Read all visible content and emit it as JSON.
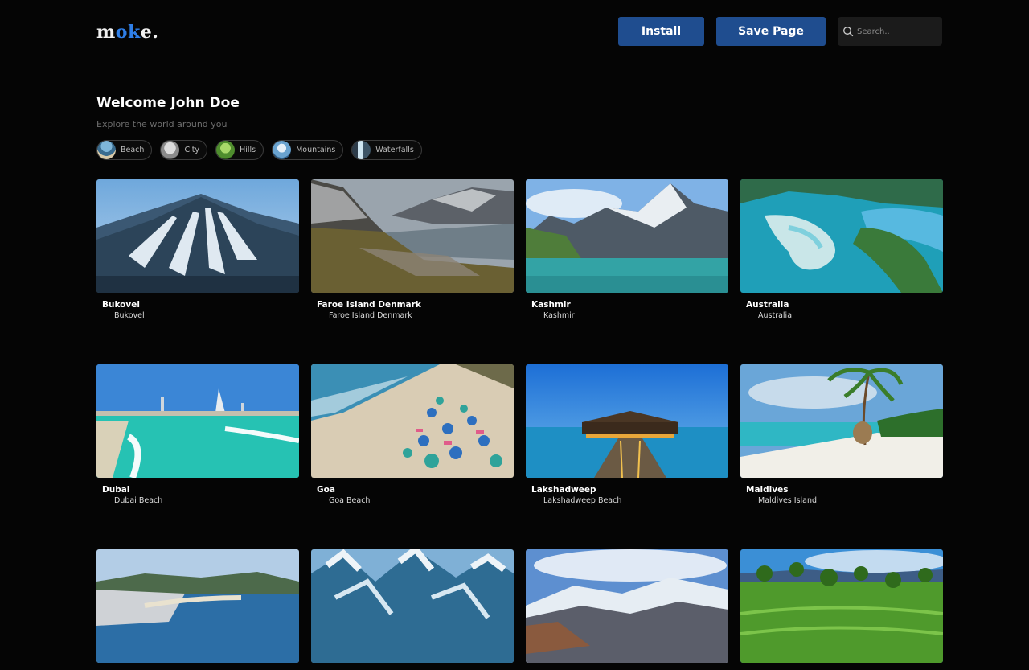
{
  "header": {
    "logo": {
      "part1": "m",
      "part2": "ok",
      "part3": "e."
    },
    "install_label": "Install",
    "save_label": "Save Page",
    "search_placeholder": "Search.."
  },
  "welcome": {
    "title": "Welcome John Doe",
    "subtitle": "Explore the world around you"
  },
  "categories": [
    {
      "label": "Beach",
      "icon": "beach-thumb"
    },
    {
      "label": "City",
      "icon": "city-thumb"
    },
    {
      "label": "Hills",
      "icon": "hills-thumb"
    },
    {
      "label": "Mountains",
      "icon": "mountains-thumb"
    },
    {
      "label": "Waterfalls",
      "icon": "waterfalls-thumb"
    }
  ],
  "places": [
    {
      "title": "Bukovel",
      "subtitle": "Bukovel"
    },
    {
      "title": "Faroe Island Denmark",
      "subtitle": "Faroe Island Denmark"
    },
    {
      "title": "Kashmir",
      "subtitle": "Kashmir"
    },
    {
      "title": "Australia",
      "subtitle": "Australia"
    },
    {
      "title": "Dubai",
      "subtitle": "Dubai Beach"
    },
    {
      "title": "Goa",
      "subtitle": "Goa Beach"
    },
    {
      "title": "Lakshadweep",
      "subtitle": "Lakshadweep Beach"
    },
    {
      "title": "Maldives",
      "subtitle": "Maldives Island"
    },
    {
      "title": "",
      "subtitle": ""
    },
    {
      "title": "",
      "subtitle": ""
    },
    {
      "title": "",
      "subtitle": ""
    },
    {
      "title": "",
      "subtitle": ""
    }
  ],
  "colors": {
    "accent": "#2f7fe8",
    "button": "#1f4d8f",
    "background": "#050505"
  }
}
